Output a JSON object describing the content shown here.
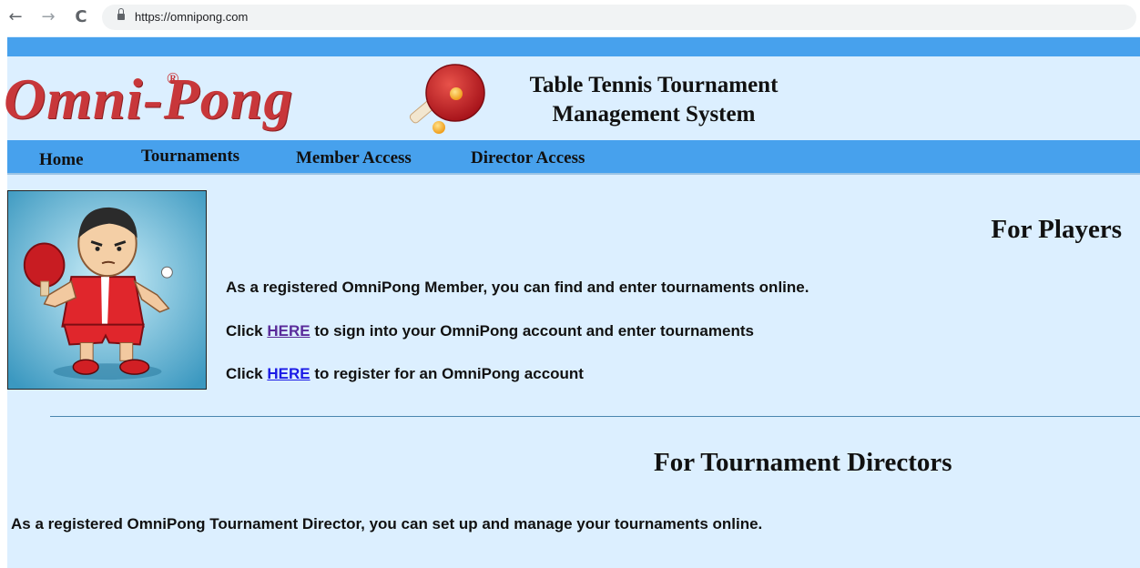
{
  "browser": {
    "url": "https://omnipong.com",
    "back_icon": "←",
    "forward_icon": "→",
    "reload_icon": "C"
  },
  "header": {
    "logo": "Omni-Pong",
    "registered_mark": "®",
    "tagline_line1": "Table Tennis Tournament",
    "tagline_line2": "Management System"
  },
  "menu": {
    "items": [
      {
        "label": "Home"
      },
      {
        "label": "Tournaments"
      },
      {
        "label": "Member Access"
      },
      {
        "label": "Director Access"
      }
    ]
  },
  "players": {
    "heading": "For Players",
    "line1": "As a registered OmniPong Member, you can find and enter tournaments online.",
    "line2_prefix": "Click ",
    "line2_link": "HERE",
    "line2_suffix": " to sign into your OmniPong account and enter tournaments",
    "line3_prefix": "Click ",
    "line3_link": "HERE",
    "line3_suffix": " to register for an OmniPong account"
  },
  "directors": {
    "heading": "For Tournament Directors",
    "line1": "As a registered OmniPong Tournament Director, you can set up and manage your tournaments online."
  },
  "colors": {
    "brand_red": "#c8373a",
    "menu_blue": "#47a1ed",
    "page_bg": "#dcefff",
    "visited_link": "#5a2b9a",
    "link": "#1a1ae6"
  }
}
